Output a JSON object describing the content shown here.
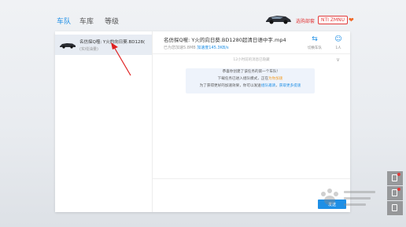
{
  "nav": {
    "tabs": [
      {
        "label": "车队",
        "active": true
      },
      {
        "label": "车库",
        "active": false
      },
      {
        "label": "等级",
        "active": false
      }
    ]
  },
  "topbar": {
    "status_text": "选购部套",
    "user_badge": "NTI ZMNU",
    "heart_icon": "heart-icon"
  },
  "sidebar": {
    "items": [
      {
        "name": "名仿探Q噬: Y火的向日葵.BD128(",
        "sub": "(实线油量)"
      }
    ]
  },
  "main": {
    "title": "名仿探Q噬: Y火的向日葵.BD1280超清日语中字.mp4",
    "status_prefix": "已为您加速5.8MB",
    "status_speed": "加速度145.3KB/s",
    "switch_label": "切换车队",
    "people_label": "1人",
    "history_label": "12小时前的消息已隐藏",
    "notice": {
      "line1": "恭喜你创建了该任务的第一个车队!",
      "line2_prefix": "下载任务已进入组队模式，正在",
      "line2_highlight": "为你加速",
      "line3_prefix": "为了获得更好的加速效果，你可以发送",
      "link_invite": "组队邀请",
      "line3_sep": "，",
      "link_more": "获取更多提速"
    },
    "send_label": "发送"
  },
  "colors": {
    "accent": "#1e8fe6",
    "alert": "#e23a3a",
    "orange": "#f39a1e"
  }
}
